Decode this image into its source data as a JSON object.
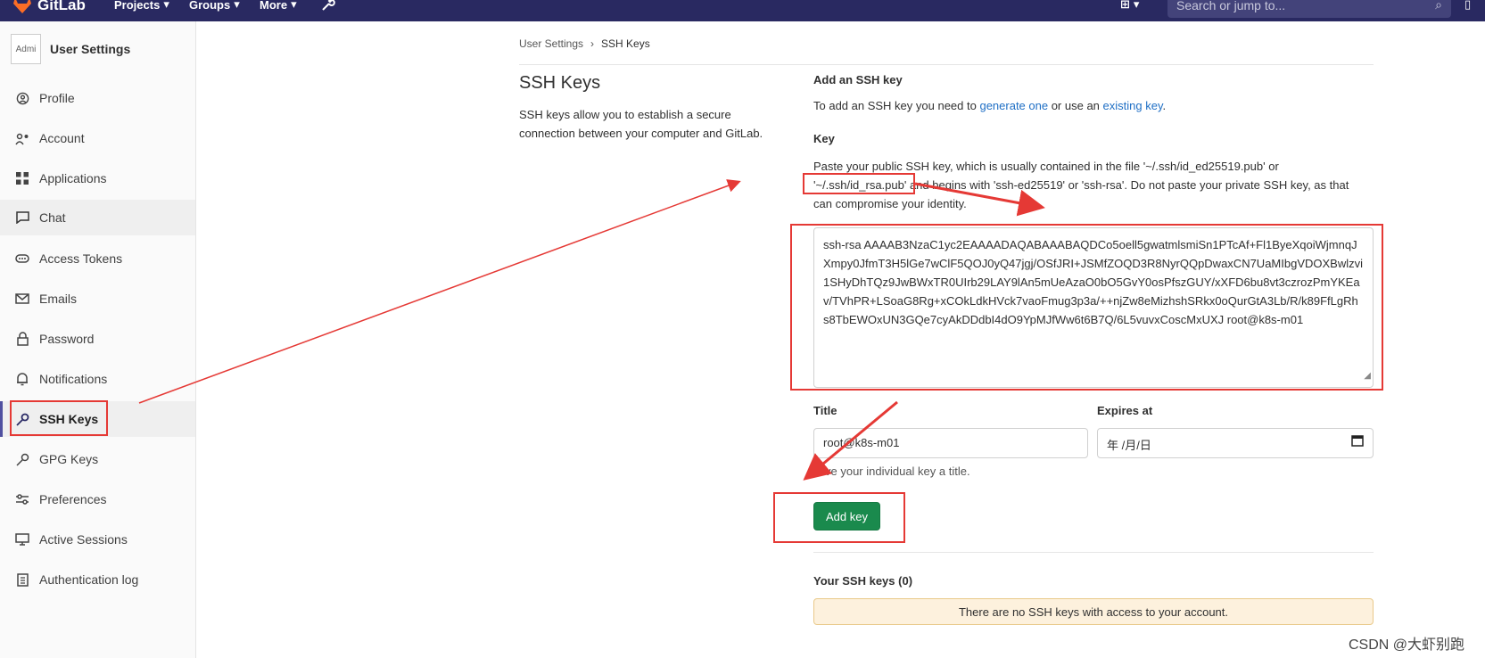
{
  "topbar": {
    "brand": "GitLab",
    "nav": [
      "Projects",
      "Groups",
      "More"
    ],
    "search_placeholder": "Search or jump to..."
  },
  "sidebar": {
    "avatar_alt": "Admi",
    "title": "User Settings",
    "items": [
      {
        "label": "Profile",
        "icon": "profile-icon"
      },
      {
        "label": "Account",
        "icon": "account-icon"
      },
      {
        "label": "Applications",
        "icon": "applications-icon"
      },
      {
        "label": "Chat",
        "icon": "chat-icon"
      },
      {
        "label": "Access Tokens",
        "icon": "token-icon"
      },
      {
        "label": "Emails",
        "icon": "mail-icon"
      },
      {
        "label": "Password",
        "icon": "lock-icon"
      },
      {
        "label": "Notifications",
        "icon": "bell-icon"
      },
      {
        "label": "SSH Keys",
        "icon": "key-icon"
      },
      {
        "label": "GPG Keys",
        "icon": "key-icon"
      },
      {
        "label": "Preferences",
        "icon": "sliders-icon"
      },
      {
        "label": "Active Sessions",
        "icon": "monitor-icon"
      },
      {
        "label": "Authentication log",
        "icon": "log-icon"
      }
    ]
  },
  "breadcrumb": {
    "parent": "User Settings",
    "separator": "›",
    "current": "SSH Keys"
  },
  "intro": {
    "title": "SSH Keys",
    "description": "SSH keys allow you to establish a secure connection between your computer and GitLab."
  },
  "form": {
    "heading": "Add an SSH key",
    "add_text_before": "To add an SSH key you need to ",
    "generate_link": "generate one",
    "add_text_middle": " or use an ",
    "existing_link": "existing key",
    "add_text_after": ".",
    "key_label": "Key",
    "key_help": "Paste your public SSH key, which is usually contained in the file '~/.ssh/id_ed25519.pub' or '~/.ssh/id_rsa.pub' and begins with 'ssh-ed25519' or 'ssh-rsa'. Do not paste your private SSH key, as that can compromise your identity.",
    "key_value": "ssh-rsa AAAAB3NzaC1yc2EAAAADAQABAAABAQDCo5oell5gwatmlsmiSn1PTcAf+Fl1ByeXqoiWjmnqJXmpy0JfmT3H5lGe7wClF5QOJ0yQ47jgj/OSfJRI+JSMfZOQD3R8NyrQQpDwaxCN7UaMIbgVDOXBwlzvi1SHyDhTQz9JwBWxTR0UIrb29LAY9lAn5mUeAzaO0bO5GvY0osPfszGUY/xXFD6bu8vt3czrozPmYKEav/TVhPR+LSoaG8Rg+xCOkLdkHVck7vaoFmug3p3a/++njZw8eMizhshSRkx0oQurGtA3Lb/R/k89FfLgRhs8TbEWOxUN3GQe7cyAkDDdbI4dO9YpMJfWw6t6B7Q/6L5vuvxCoscMxUXJ root@k8s-m01",
    "title_label": "Title",
    "title_value": "root@k8s-m01",
    "expires_label": "Expires at",
    "expires_placeholder": "年 /月/日",
    "title_hint": "Give your individual key a title.",
    "submit_label": "Add key"
  },
  "your_keys": {
    "heading": "Your SSH keys (0)",
    "empty_message": "There are no SSH keys with access to your account."
  },
  "watermark": "CSDN @大虾别跑",
  "colors": {
    "topbar": "#292961",
    "accent_green": "#1a8a4d",
    "annotation_red": "#e53935",
    "link_blue": "#1f6fc5"
  }
}
